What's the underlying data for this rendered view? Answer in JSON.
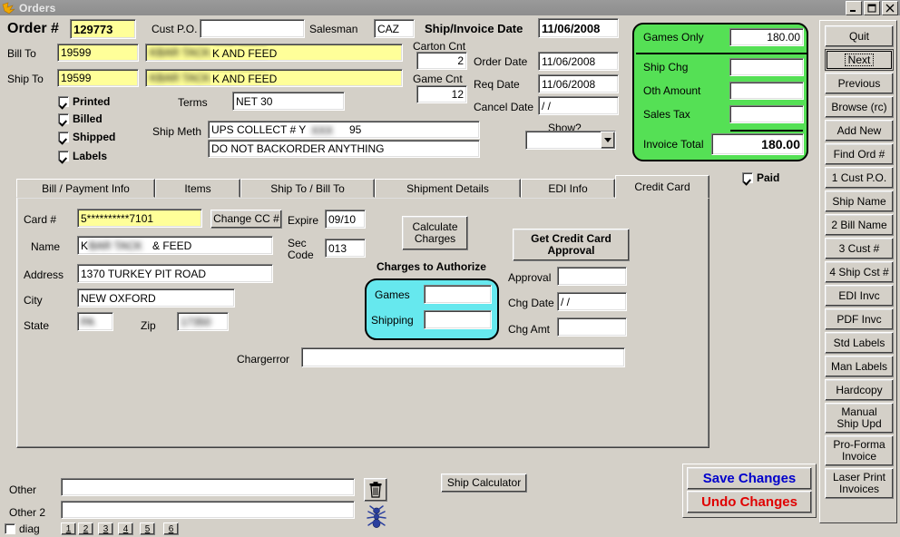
{
  "window": {
    "title": "Orders",
    "icon": "app-orders-icon",
    "buttons": {
      "minimize": "_",
      "maximize": "□",
      "close": "✕"
    }
  },
  "header": {
    "order_no_label": "Order #",
    "order_no_value": "129773",
    "cust_po_label": "Cust P.O.",
    "cust_po_value": "",
    "salesman_label": "Salesman",
    "salesman_value": "CAZ",
    "ship_invoice_date_label": "Ship/Invoice Date",
    "ship_invoice_date_value": "11/06/2008",
    "bill_to_label": "Bill To",
    "bill_to_code": "19599",
    "bill_to_name": "KBAR TACK AND FEED",
    "ship_to_label": "Ship To",
    "ship_to_code": "19599",
    "ship_to_name": "KBAR TACK AND FEED",
    "carton_cnt_label": "Carton Cnt",
    "carton_cnt_value": "2",
    "game_cnt_label": "Game Cnt",
    "game_cnt_value": "12",
    "order_date_label": "Order Date",
    "order_date_value": "11/06/2008",
    "req_date_label": "Req Date",
    "req_date_value": "11/06/2008",
    "cancel_date_label": "Cancel Date",
    "cancel_date_value": "/  /",
    "terms_label": "Terms",
    "terms_value": "NET 30",
    "ship_meth_label": "Ship Meth",
    "ship_meth_value": "UPS COLLECT # Y      95",
    "ship_note_value": "DO NOT BACKORDER ANYTHING",
    "show_label": "Show?",
    "show_value": "",
    "checkboxes": [
      {
        "label": "Printed",
        "checked": true
      },
      {
        "label": "Billed",
        "checked": true
      },
      {
        "label": "Shipped",
        "checked": true
      },
      {
        "label": "Labels",
        "checked": true
      }
    ]
  },
  "totals": {
    "panel_color": "#55e055",
    "rows": [
      {
        "label": "Games Only",
        "value": "180.00"
      },
      {
        "label": "Ship Chg",
        "value": ""
      },
      {
        "label": "Oth Amount",
        "value": ""
      },
      {
        "label": "Sales Tax",
        "value": ""
      },
      {
        "label": "Invoice Total",
        "value": "180.00"
      }
    ]
  },
  "paid": {
    "label": "Paid",
    "checked": true
  },
  "tabs": [
    {
      "label": "Bill / Payment Info",
      "selected": false
    },
    {
      "label": "Items",
      "selected": false
    },
    {
      "label": "Ship To  /  Bill To",
      "selected": false
    },
    {
      "label": "Shipment Details",
      "selected": false
    },
    {
      "label": "EDI Info",
      "selected": false
    },
    {
      "label": "Credit Card",
      "selected": true
    }
  ],
  "credit_card": {
    "card_label": "Card #",
    "card_value": "5**********7101",
    "change_cc_label": "Change CC #",
    "expire_label": "Expire",
    "expire_value": "09/10",
    "name_label": "Name",
    "name_value": "KBAR TACK & FEED",
    "sec_code_label": "Sec\nCode",
    "sec_code_value": "013",
    "address_label": "Address",
    "address_value": "1370 TURKEY PIT ROAD",
    "city_label": "City",
    "city_value": "NEW OXFORD",
    "state_label": "State",
    "state_value": "PA",
    "zip_label": "Zip",
    "zip_value": "17350",
    "calculate_charges_label": "Calculate\nCharges",
    "get_approval_label": "Get Credit Card\nApproval",
    "charges_to_authorize_label": "Charges to Authorize",
    "charges_panel_color": "#66e8ee",
    "charges": [
      {
        "label": "Games",
        "value": ""
      },
      {
        "label": "Shipping",
        "value": ""
      }
    ],
    "approval_label": "Approval",
    "approval_value": "",
    "chg_date_label": "Chg Date",
    "chg_date_value": "/  /",
    "chg_amt_label": "Chg Amt",
    "chg_amt_value": "",
    "chargerror_label": "Chargerror",
    "chargerror_value": ""
  },
  "footer": {
    "other_label": "Other",
    "other_value": "",
    "other2_label": "Other 2",
    "other2_value": "",
    "diag_label": "diag",
    "diag_checked": false,
    "page_buttons": [
      "1",
      "2",
      "3",
      "4",
      "5",
      "6"
    ],
    "delete_icon": "trash-can-icon",
    "bug_icon": "ant-bug-icon",
    "ship_calculator_label": "Ship Calculator",
    "save_changes_label": "Save Changes",
    "undo_changes_label": "Undo Changes",
    "save_color": "#0000cc",
    "undo_color": "#e00000"
  },
  "rail": {
    "buttons": [
      {
        "label": "Quit",
        "accel": "Q",
        "focus": false
      },
      {
        "label": "Next",
        "accel": "N",
        "focus": true
      },
      {
        "label": "Previous",
        "accel": "P",
        "focus": false
      },
      {
        "label": "Browse (rc)",
        "accel": "B",
        "focus": false
      },
      {
        "label": "Add New",
        "accel": "A",
        "focus": false
      },
      {
        "label": "Find Ord #",
        "accel": "F",
        "focus": false
      },
      {
        "label": "1 Cust P.O.",
        "accel": "1",
        "focus": false
      },
      {
        "label": "Ship Name",
        "accel": "",
        "focus": false
      },
      {
        "label": "2 Bill Name",
        "accel": "2",
        "focus": false
      },
      {
        "label": "3 Cust #",
        "accel": "3",
        "focus": false
      },
      {
        "label": "4 Ship Cst #",
        "accel": "4",
        "focus": false
      },
      {
        "label": "EDI Invc",
        "accel": "E",
        "focus": false
      },
      {
        "label": "PDF Invc",
        "accel": "",
        "focus": false
      },
      {
        "label": "Std Labels",
        "accel": "",
        "focus": false
      },
      {
        "label": "Man Labels",
        "accel": "",
        "focus": false
      },
      {
        "label": "Hardcopy",
        "accel": "H",
        "focus": false
      },
      {
        "label": "Manual\nShip Upd",
        "accel": "",
        "focus": false
      },
      {
        "label": "Pro-Forma\nInvoice",
        "accel": "",
        "focus": false
      },
      {
        "label": "Laser Print\nInvoices",
        "accel": "",
        "focus": false
      }
    ]
  }
}
